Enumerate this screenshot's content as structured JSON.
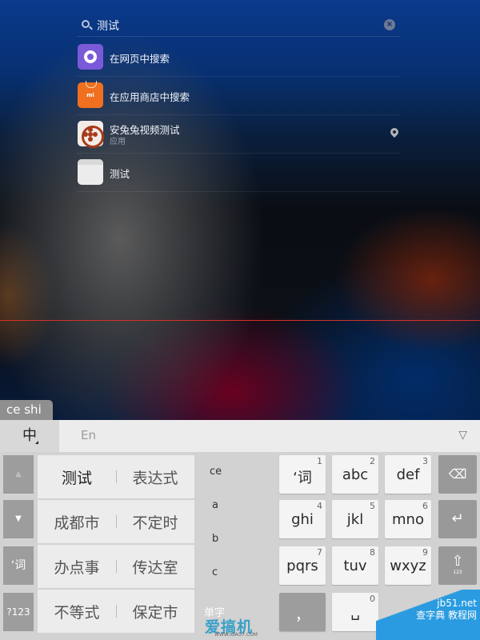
{
  "search": {
    "query": "测试",
    "search_icon": "search-icon",
    "clear_icon": "clear-icon"
  },
  "results": [
    {
      "title": "在网页中搜索",
      "icon": "browser-icon"
    },
    {
      "title": "在应用商店中搜索",
      "icon": "app-store-icon",
      "icon_text": "mi"
    },
    {
      "title": "安兔兔视频测试",
      "subtitle": "应用",
      "icon": "video-app-icon",
      "action_icon": "location-pin-icon"
    },
    {
      "title": "测试",
      "icon": "note-icon"
    }
  ],
  "composing": "ce shi",
  "keyboard": {
    "mode_zh": "中",
    "mode_en": "En",
    "collapse": "▽",
    "side_keys": {
      "up": "▲",
      "down": "▼",
      "word": "‘词",
      "num": "?123"
    },
    "candidates": [
      [
        "测试",
        "表达式"
      ],
      [
        "成都市",
        "不定时"
      ],
      [
        "办点事",
        "传达室"
      ],
      [
        "不等式",
        "保定市"
      ]
    ],
    "pinyin_options": [
      "ce",
      "a",
      "b",
      "c"
    ],
    "single_char": "单字",
    "keys": [
      {
        "label": "‘词",
        "num": "1"
      },
      {
        "label": "abc",
        "num": "2"
      },
      {
        "label": "def",
        "num": "3"
      },
      {
        "label": "ghi",
        "num": "4"
      },
      {
        "label": "jkl",
        "num": "5"
      },
      {
        "label": "mno",
        "num": "6"
      },
      {
        "label": "pqrs",
        "num": "7"
      },
      {
        "label": "tuv",
        "num": "8"
      },
      {
        "label": "wxyz",
        "num": "9"
      },
      {
        "label": "，",
        "num": ""
      },
      {
        "label": "␣",
        "num": "0"
      }
    ],
    "function_keys": {
      "backspace": "⌫",
      "enter": "↵",
      "shift": "⇧",
      "shift_sub": "123"
    }
  },
  "watermarks": {
    "left": "爱搞机",
    "left_url": "WWW.IGAO7.COM",
    "right_top": "jb51.net",
    "right": "查字典 教程网"
  }
}
